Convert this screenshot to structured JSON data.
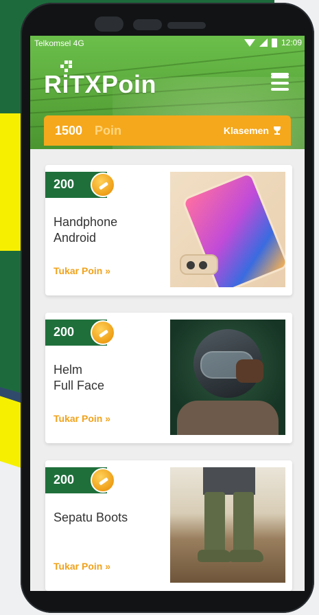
{
  "status_bar": {
    "carrier": "Telkomsel 4G",
    "time": "12:09"
  },
  "app": {
    "logo_text": "RiTXPoin"
  },
  "points": {
    "value": "1500",
    "unit": "Poin",
    "rank_label": "Klasemen"
  },
  "rewards": [
    {
      "price": "200",
      "name": "Handphone\nAndroid",
      "action": "Tukar Poin »"
    },
    {
      "price": "200",
      "name": "Helm\nFull Face",
      "action": "Tukar Poin »"
    },
    {
      "price": "200",
      "name": "Sepatu Boots",
      "action": "Tukar Poin »"
    }
  ],
  "colors": {
    "brand_green": "#1f6f3b",
    "accent_orange": "#f5a81c",
    "header_green": "#5aa83c",
    "notification_red": "#e02020"
  },
  "icons": {
    "menu": "hamburger-menu-icon",
    "coin": "coin-icon",
    "trophy": "trophy-icon",
    "wifi": "wifi-icon",
    "signal": "signal-icon",
    "battery": "battery-icon"
  }
}
